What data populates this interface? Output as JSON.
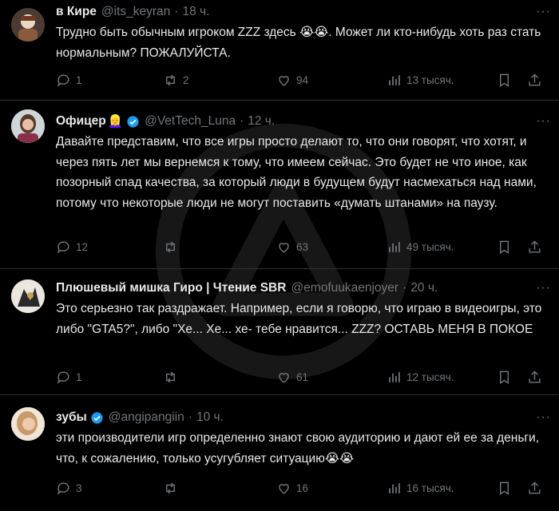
{
  "tweets": [
    {
      "name": "в Кире",
      "name_emoji": "",
      "verified": false,
      "handle": "@its_keyran",
      "time": "18 ч.",
      "text": "Трудно быть обычным игроком ZZZ здесь 😭😭. Может ли кто-нибудь хоть раз стать нормальным? ПОЖАЛУЙСТА.",
      "replies": "1",
      "retweets": "2",
      "likes": "94",
      "views": "13 тысяч."
    },
    {
      "name": "Офицер",
      "name_emoji": "👱‍♀️",
      "verified": true,
      "handle": "@VetTech_Luna",
      "time": "12 ч.",
      "text": "Давайте представим, что все игры просто делают то, что они говорят, что хотят, и через пять лет мы вернемся к тому, что имеем сейчас. Это будет не что иное, как позорный спад качества, за который люди в будущем будут насмехаться над нами, потому что некоторые люди не могут поставить «думать штанами» на паузу.",
      "replies": "12",
      "retweets": "",
      "likes": "63",
      "views": "49 тысяч."
    },
    {
      "name": "Плюшевый мишка Гиро | Чтение SBR",
      "name_emoji": "",
      "verified": false,
      "handle": "@emofuukaenjoyer",
      "time": "20 ч.",
      "text": "Это серьезно так раздражает. Например, если я говорю, что играю в видеоигры, это либо \"GTA5?\", либо \"Хе... Хе... хе- тебе нравится... ZZZ? ОСТАВЬ МЕНЯ В ПОКОЕ",
      "replies": "1",
      "retweets": "",
      "likes": "61",
      "views": "12 тысяч."
    },
    {
      "name": "зубы",
      "name_emoji": "",
      "verified": true,
      "handle": "@angipangiin",
      "time": "10 ч.",
      "text": "эти производители игр определенно знают свою аудиторию и дают ей ее за деньги, что, к сожалению, только усугубляет ситуацию😭😭",
      "replies": "3",
      "retweets": "",
      "likes": "16",
      "views": "16 тысяч."
    }
  ],
  "icons": {
    "reply": "reply-icon",
    "retweet": "retweet-icon",
    "like": "heart-icon",
    "views": "views-icon",
    "bookmark": "bookmark-icon",
    "share": "share-icon",
    "more": "more-icon"
  },
  "colors": {
    "background": "#000000",
    "text": "#e7e9ea",
    "muted": "#71767b",
    "verified": "#1d9bf0",
    "divider": "#2f3336"
  }
}
